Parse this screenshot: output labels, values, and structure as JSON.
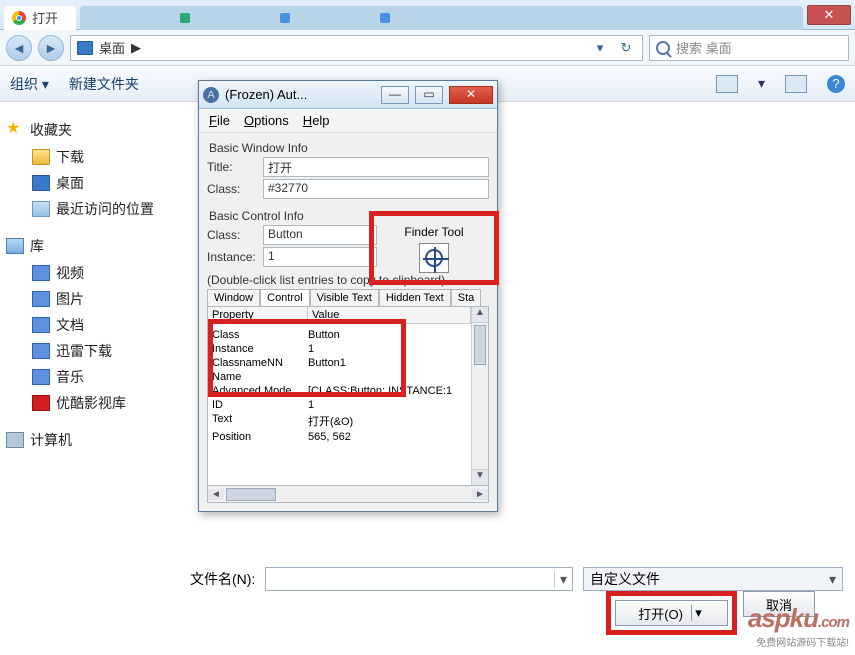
{
  "chrome": {
    "tab_title": "打开",
    "close_glyph": "✕"
  },
  "explorer": {
    "addr_location": "桌面",
    "addr_arrow": "▶",
    "search_placeholder": "搜索 桌面",
    "toolbar": {
      "organize": "组织 ▾",
      "newfolder": "新建文件夹"
    },
    "tree": {
      "favorites": "收藏夹",
      "downloads": "下载",
      "desktop": "桌面",
      "recent": "最近访问的位置",
      "libraries": "库",
      "videos": "视频",
      "pictures": "图片",
      "documents": "文档",
      "xunlei": "迅雷下载",
      "music": "音乐",
      "youku": "优酷影视库",
      "computer": "计算机"
    },
    "file_label": "文件名(N):",
    "type_value": "自定义文件",
    "open_btn": "打开(O)",
    "cancel_btn": "取消"
  },
  "autoit": {
    "title": "(Frozen) Aut...",
    "menu": {
      "file": "File",
      "options": "Options",
      "help": "Help"
    },
    "basic_window": "Basic Window Info",
    "title_lbl": "Title:",
    "title_val": "打开",
    "class_lbl": "Class:",
    "class_val": "#32770",
    "basic_control": "Basic Control Info",
    "ctrl_class_lbl": "Class:",
    "ctrl_class_val": "Button",
    "inst_lbl": "Instance:",
    "inst_val": "1",
    "finder_lbl": "Finder Tool",
    "hint": "(Double-click list entries to copy to clipboard)",
    "tabs": {
      "window": "Window",
      "control": "Control",
      "visible": "Visible Text",
      "hidden": "Hidden Text",
      "sta": "Sta"
    },
    "list_head": {
      "prop": "Property",
      "val": "Value"
    },
    "rows": [
      {
        "p": "Class",
        "v": "Button"
      },
      {
        "p": "Instance",
        "v": "1"
      },
      {
        "p": "ClassnameNN",
        "v": "Button1"
      },
      {
        "p": "Name",
        "v": ""
      },
      {
        "p": "Advanced Mode",
        "v": "[CLASS:Button; INSTANCE:1"
      },
      {
        "p": "ID",
        "v": "1"
      },
      {
        "p": "Text",
        "v": "打开(&O)"
      },
      {
        "p": "Position",
        "v": "565, 562"
      }
    ]
  },
  "watermark": {
    "big": "aspku",
    "dom": ".com",
    "small": "免费网站源码下载站!"
  }
}
